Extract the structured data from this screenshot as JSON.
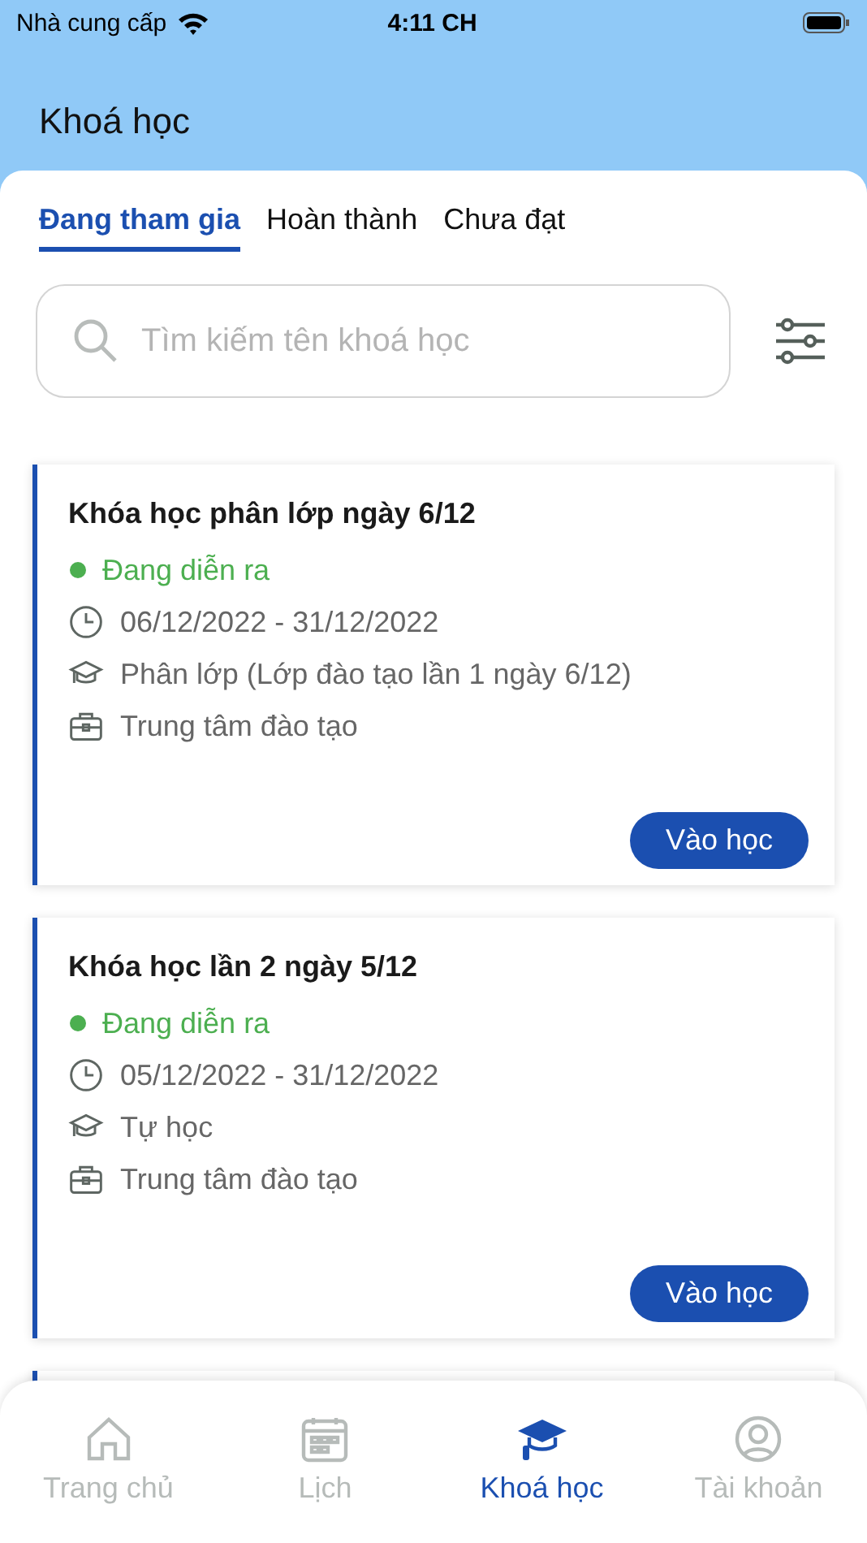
{
  "status_bar": {
    "carrier": "Nhà cung cấp",
    "time": "4:11 CH"
  },
  "header": {
    "title": "Khoá học"
  },
  "tabs": [
    {
      "label": "Đang tham gia",
      "selected": true
    },
    {
      "label": "Hoàn thành",
      "selected": false
    },
    {
      "label": "Chưa đạt",
      "selected": false
    }
  ],
  "search": {
    "placeholder": "Tìm kiếm tên khoá học"
  },
  "courses": [
    {
      "title": "Khóa học phân lớp ngày 6/12",
      "status": {
        "label": "Đang diễn ra",
        "color": "#4caf50"
      },
      "details": [
        {
          "kind": "date",
          "text": "06/12/2022 - 31/12/2022"
        },
        {
          "kind": "type",
          "text": "Phân lớp (Lớp đào tạo lần 1 ngày 6/12)"
        },
        {
          "kind": "organizer",
          "text": "Trung tâm đào tạo"
        }
      ],
      "button": "Vào học"
    },
    {
      "title": "Khóa học lần 2 ngày 5/12",
      "status": {
        "label": "Đang diễn ra",
        "color": "#4caf50"
      },
      "details": [
        {
          "kind": "date",
          "text": "05/12/2022 - 31/12/2022"
        },
        {
          "kind": "type",
          "text": "Tự học"
        },
        {
          "kind": "organizer",
          "text": "Trung tâm đào tạo"
        }
      ],
      "button": "Vào học"
    }
  ],
  "bottom_nav": [
    {
      "kind": "home",
      "label": "Trang chủ",
      "selected": false
    },
    {
      "kind": "calendar",
      "label": "Lịch",
      "selected": false
    },
    {
      "kind": "course",
      "label": "Khoá học",
      "selected": true
    },
    {
      "kind": "account",
      "label": "Tài khoản",
      "selected": false
    }
  ]
}
